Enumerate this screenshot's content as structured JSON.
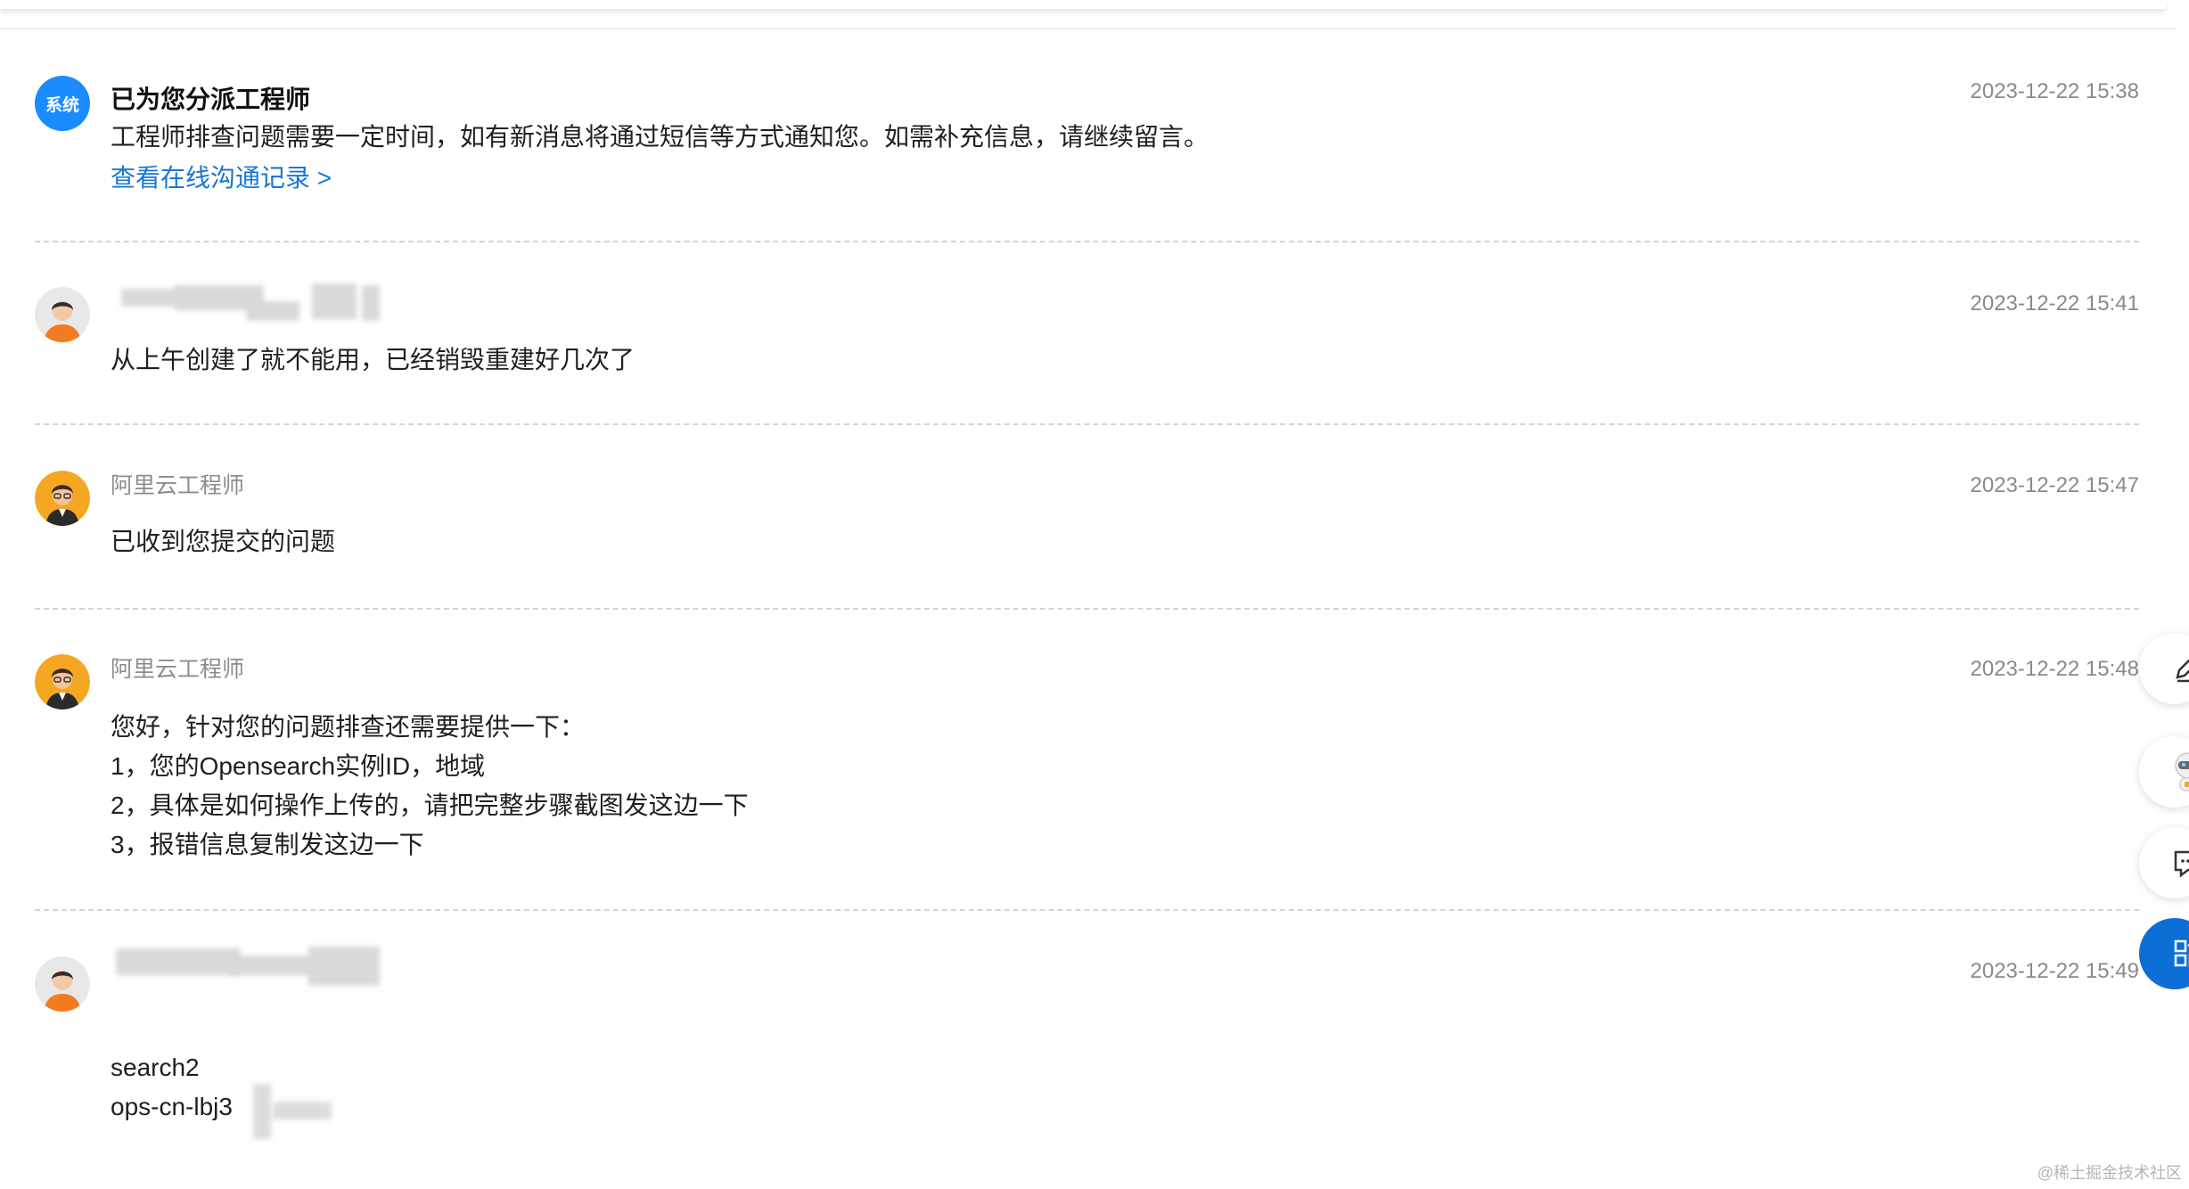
{
  "messages": [
    {
      "sender": "已为您分派工程师",
      "avatar_label": "系统",
      "time": "2023-12-22 15:38",
      "lines": [
        "工程师排查问题需要一定时间，如有新消息将通过短信等方式通知您。如需补充信息，请继续留言。"
      ],
      "link": "查看在线沟通记录 >"
    },
    {
      "sender": "",
      "time": "2023-12-22 15:41",
      "lines": [
        "从上午创建了就不能用，已经销毁重建好几次了"
      ]
    },
    {
      "sender": "阿里云工程师",
      "time": "2023-12-22 15:47",
      "lines": [
        "已收到您提交的问题"
      ]
    },
    {
      "sender": "阿里云工程师",
      "time": "2023-12-22 15:48",
      "lines": [
        "您好，针对您的问题排查还需要提供一下：",
        "1，您的Opensearch实例ID，地域",
        "2，具体是如何操作上传的，请把完整步骤截图发这边一下",
        "3，报错信息复制发这边一下"
      ]
    },
    {
      "sender": "",
      "time": "2023-12-22 15:49",
      "lines": [
        "search2",
        "ops-cn-lbj3"
      ]
    }
  ],
  "sidebar": {
    "edit": "edit-icon",
    "assistant": "robot-assistant-icon",
    "chat": "chat-bubble-icon",
    "apps": "apps-grid-icon"
  },
  "watermark": "@稀土掘金技术社区",
  "colors": {
    "link": "#1677d2",
    "system": "#1a8cff",
    "accent": "#0d6fd6"
  }
}
